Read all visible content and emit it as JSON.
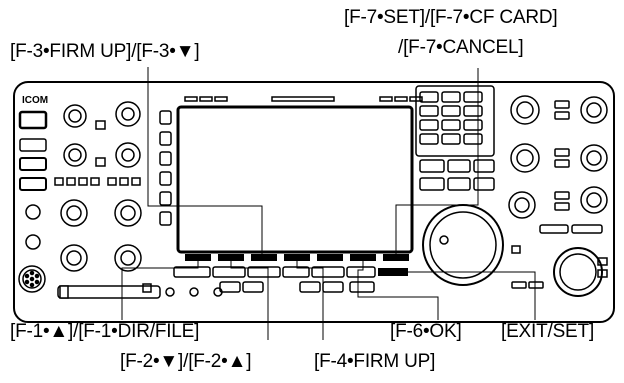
{
  "brand": "ICOM",
  "labels": {
    "f7_line1": "[F-7•SET]/[F-7•CF CARD]",
    "f7_line2": "/[F-7•CANCEL]",
    "f3": "[F-3•FIRM UP]/[F-3•▼]",
    "f1": "[F-1•▲]/[F-1•DIR/FILE]",
    "f2": "[F-2•▼]/[F-2•▲]",
    "f4": "[F-4•FIRM UP]",
    "f6": "[F-6•OK]",
    "exit": "[EXIT/SET]"
  }
}
